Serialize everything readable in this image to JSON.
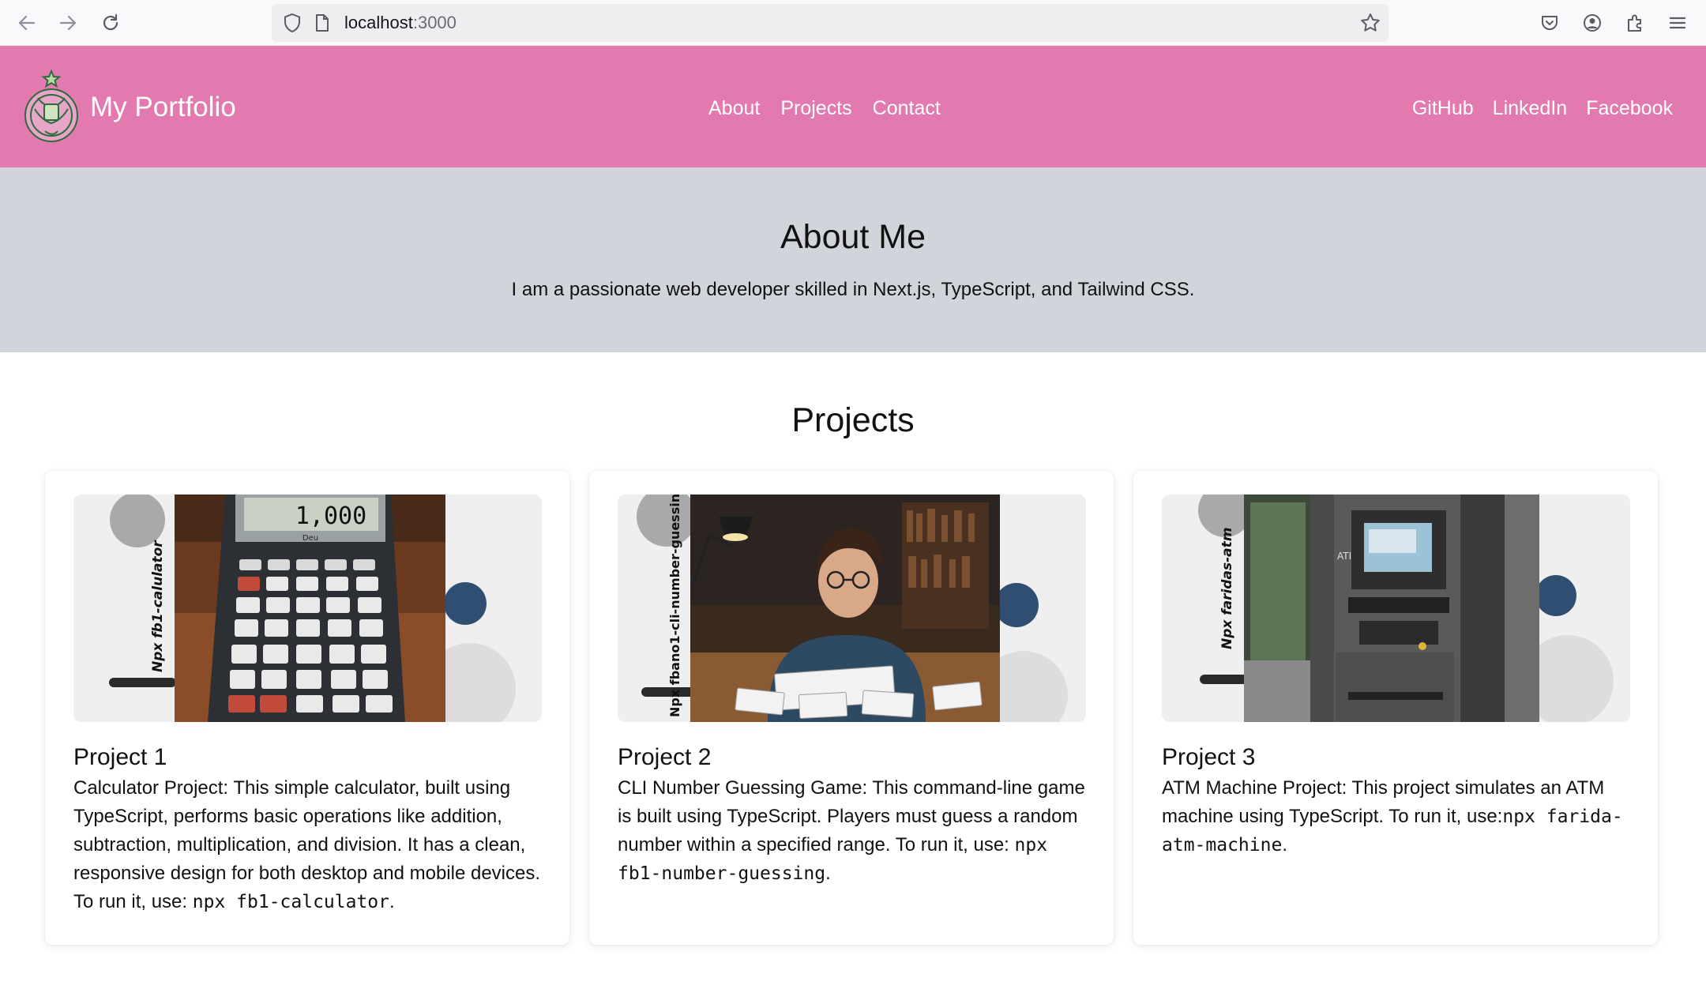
{
  "browser": {
    "url_host": "localhost",
    "url_port": ":3000"
  },
  "header": {
    "brand": "My Portfolio",
    "nav": [
      "About",
      "Projects",
      "Contact"
    ],
    "social": [
      "GitHub",
      "LinkedIn",
      "Facebook"
    ],
    "bg_color": "#e27ab0"
  },
  "about": {
    "title": "About Me",
    "text": "I am a passionate web developer skilled in Next.js, TypeScript, and Tailwind CSS."
  },
  "projects": {
    "title": "Projects",
    "items": [
      {
        "title": "Project 1",
        "desc": "Calculator Project: This simple calculator, built using TypeScript, performs basic operations like addition, subtraction, multiplication, and division. It has a clean, responsive design for both desktop and mobile devices. To run it, use: ",
        "command": "npx fb1-calculator",
        "tail": ".",
        "image_label": "Npx fb1-calulator",
        "image_text": "1,000",
        "image_brand": "Deu"
      },
      {
        "title": "Project 2",
        "desc": "CLI Number Guessing Game: This command-line game is built using TypeScript. Players must guess a random number within a specified range. To run it, use: ",
        "command": "npx fb1-number-guessing",
        "tail": ".",
        "image_label": "Npx fbano1-cli-number-guessing"
      },
      {
        "title": "Project 3",
        "desc": "ATM Machine Project: This project simulates an ATM machine using TypeScript. To run it, use:",
        "command": "npx farida-atm-machine",
        "tail": ".",
        "image_label": "Npx faridas-atm",
        "image_text": "ATI"
      }
    ]
  }
}
